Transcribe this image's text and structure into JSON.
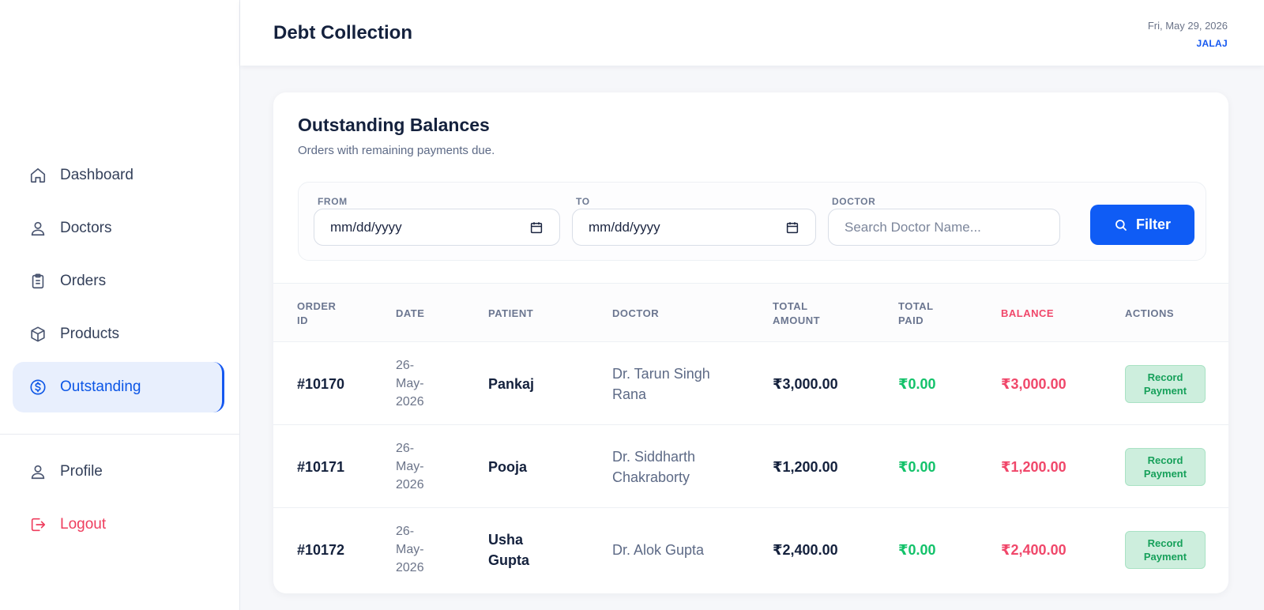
{
  "sidebar": {
    "items": [
      {
        "label": "Dashboard",
        "icon": "home-icon"
      },
      {
        "label": "Doctors",
        "icon": "user-icon"
      },
      {
        "label": "Orders",
        "icon": "clipboard-icon"
      },
      {
        "label": "Products",
        "icon": "box-icon"
      },
      {
        "label": "Outstanding",
        "icon": "dollar-circle-icon",
        "active": true
      }
    ],
    "bottom_items": [
      {
        "label": "Profile",
        "icon": "user-icon"
      },
      {
        "label": "Logout",
        "icon": "logout-icon"
      }
    ]
  },
  "header": {
    "title": "Debt Collection",
    "date": "Fri, May 29, 2026",
    "user": "JALAJ"
  },
  "main": {
    "title": "Outstanding Balances",
    "subtitle": "Orders with remaining payments due.",
    "filters": {
      "from_label": "FROM",
      "from_value": "mm/dd/yyyy",
      "to_label": "TO",
      "to_value": "mm/dd/yyyy",
      "doctor_label": "DOCTOR",
      "doctor_placeholder": "Search Doctor Name...",
      "filter_button": "Filter"
    },
    "table": {
      "headers": {
        "order_id": [
          "ORDER",
          "ID"
        ],
        "date": "DATE",
        "patient": "PATIENT",
        "doctor": "DOCTOR",
        "total_amount": [
          "TOTAL",
          "AMOUNT"
        ],
        "total_paid": [
          "TOTAL",
          "PAID"
        ],
        "balance": "BALANCE",
        "actions": "ACTIONS"
      },
      "rows": [
        {
          "id": "#10170",
          "date": [
            "26-",
            "May-",
            "2026"
          ],
          "patient": [
            "Pankaj"
          ],
          "doctor": [
            "Dr. Tarun Singh",
            "Rana"
          ],
          "total": "₹3,000.00",
          "paid": "₹0.00",
          "balance": "₹3,000.00",
          "action": [
            "Record",
            "Payment"
          ]
        },
        {
          "id": "#10171",
          "date": [
            "26-",
            "May-",
            "2026"
          ],
          "patient": [
            "Pooja"
          ],
          "doctor": [
            "Dr. Siddharth",
            "Chakraborty"
          ],
          "total": "₹1,200.00",
          "paid": "₹0.00",
          "balance": "₹1,200.00",
          "action": [
            "Record",
            "Payment"
          ]
        },
        {
          "id": "#10172",
          "date": [
            "26-",
            "May-",
            "2026"
          ],
          "patient": [
            "Usha",
            "Gupta"
          ],
          "doctor": [
            "Dr. Alok Gupta"
          ],
          "total": "₹2,400.00",
          "paid": "₹0.00",
          "balance": "₹2,400.00",
          "action": [
            "Record",
            "Payment"
          ]
        }
      ]
    }
  },
  "colors": {
    "accent": "#0f5cf5",
    "paid_green": "#13c26a",
    "balance_red": "#f0476a",
    "logout_red": "#ee3e5e"
  }
}
